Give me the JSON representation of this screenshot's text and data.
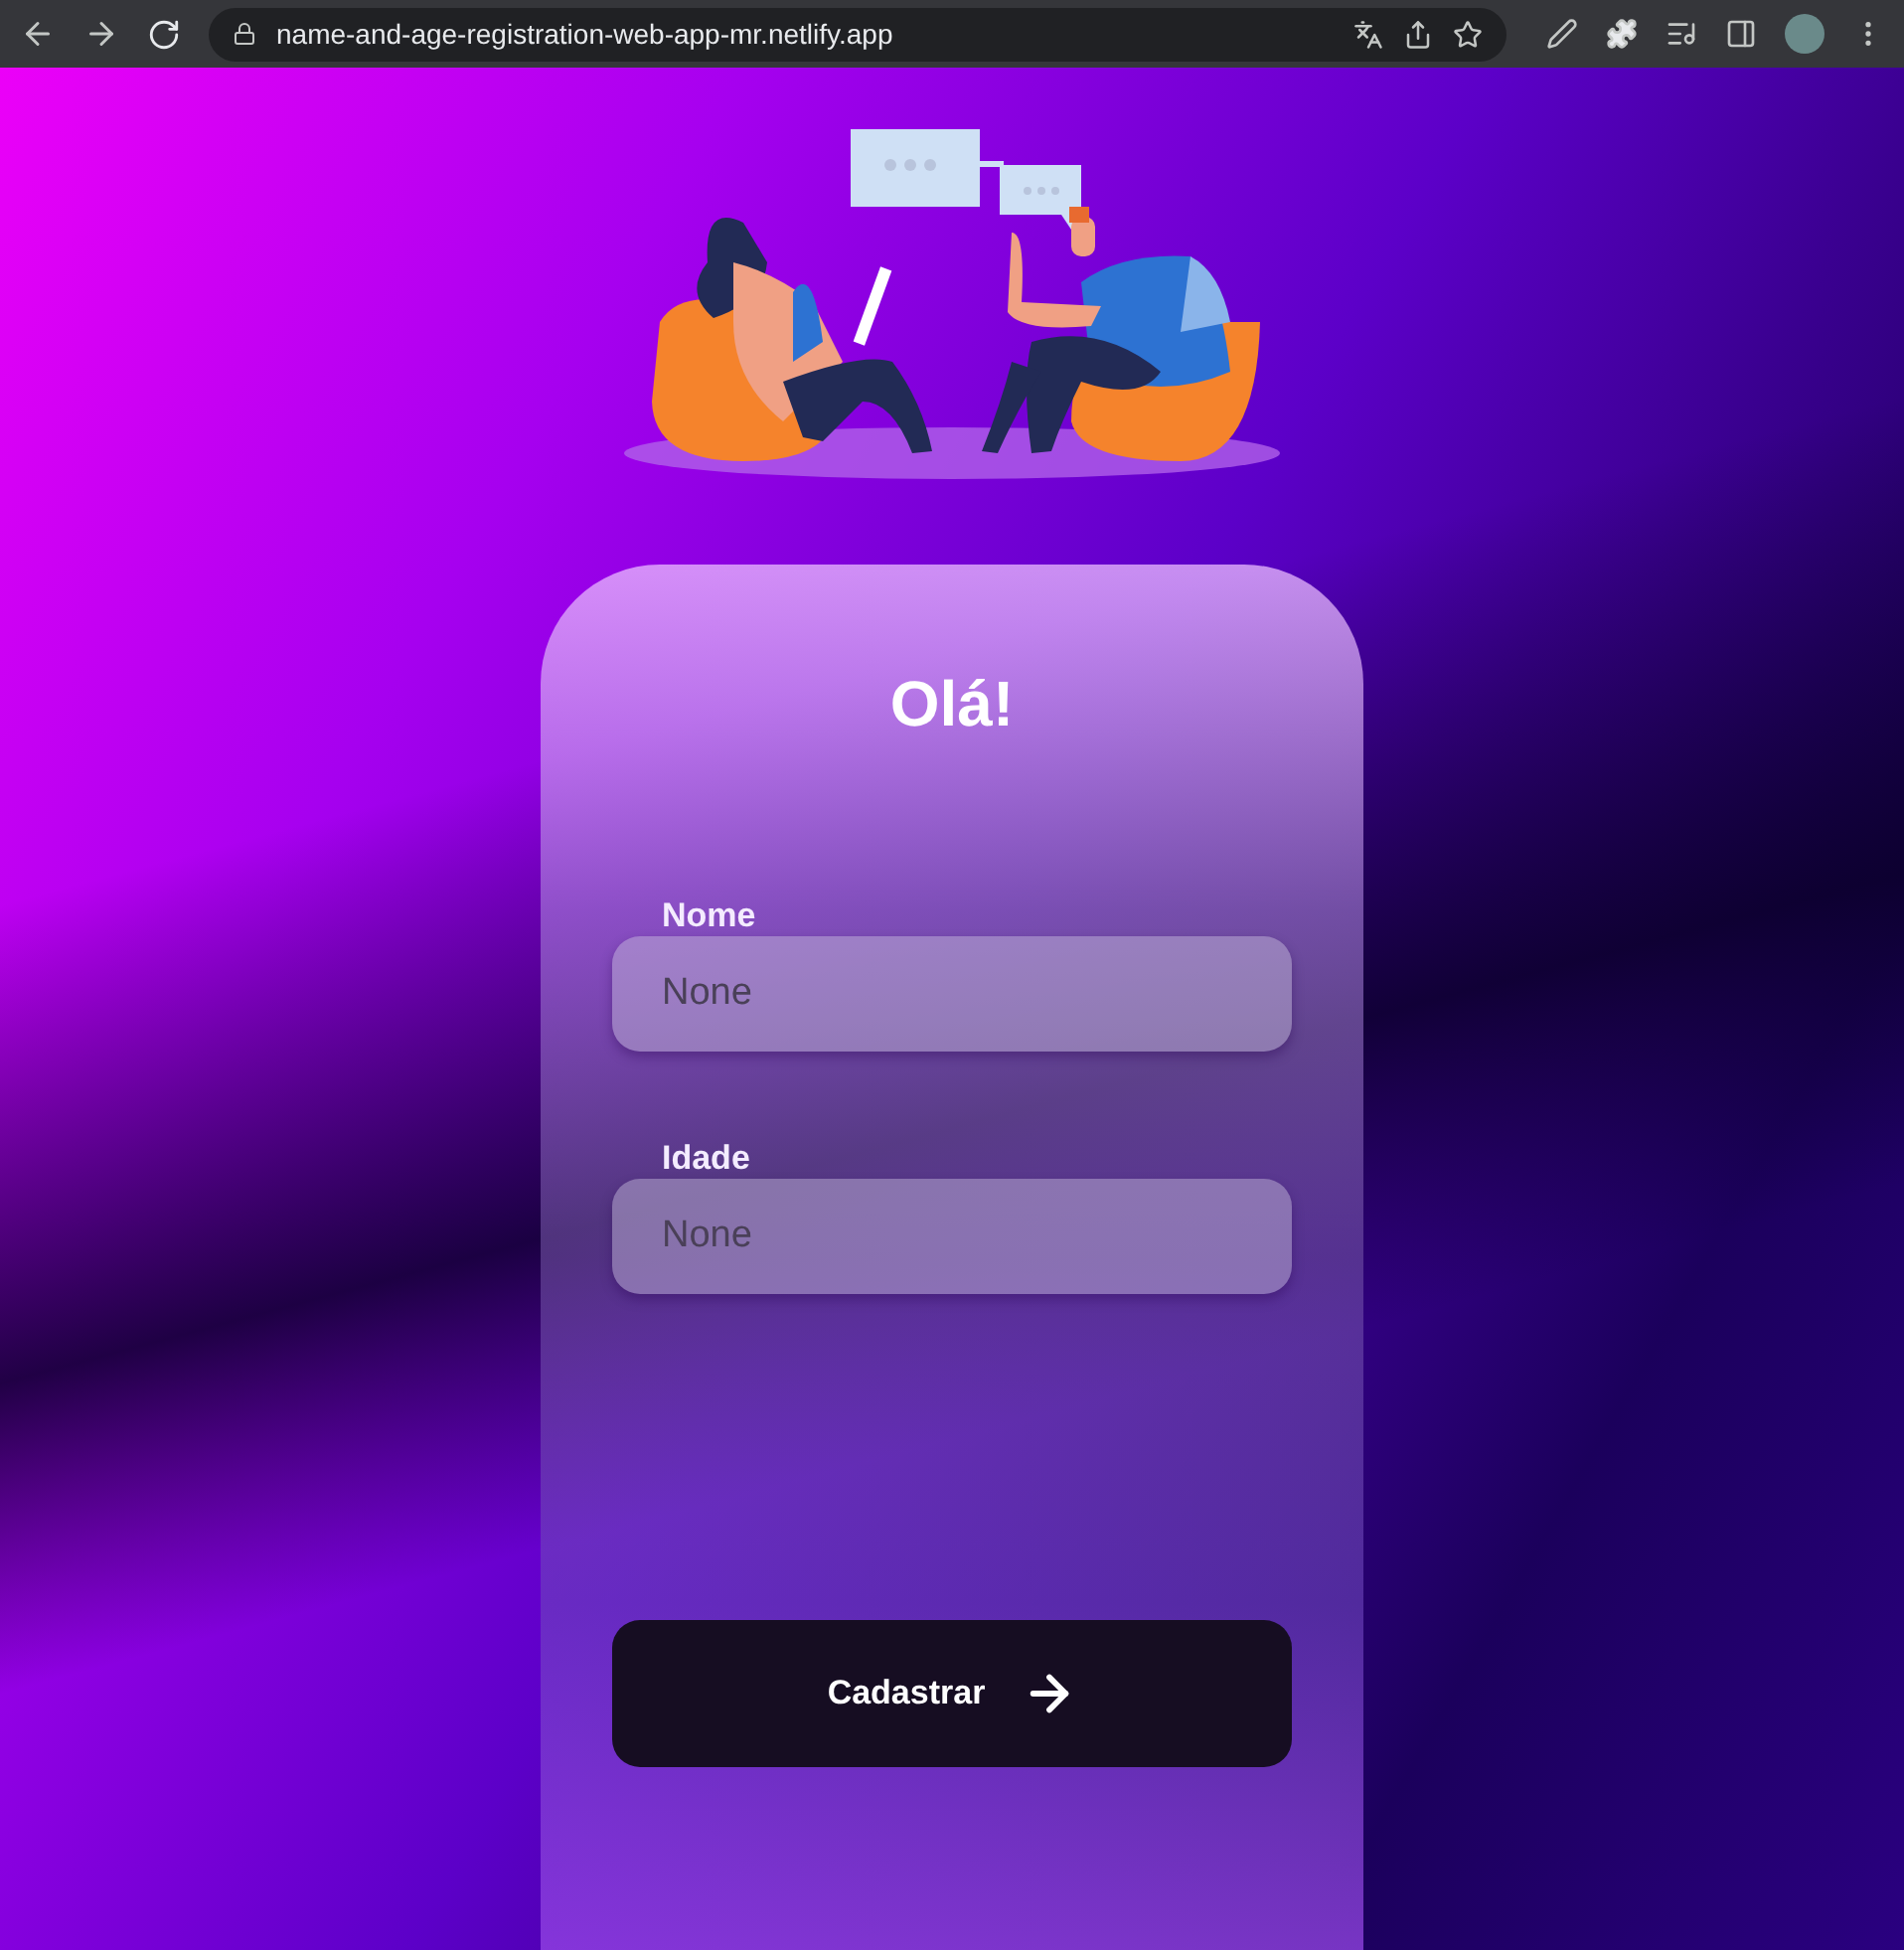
{
  "browser": {
    "url": "name-and-age-registration-web-app-mr.netlify.app"
  },
  "form": {
    "title": "Olá!",
    "fields": [
      {
        "label": "Nome",
        "placeholder": "None"
      },
      {
        "label": "Idade",
        "placeholder": "None"
      }
    ],
    "submit": "Cadastrar"
  }
}
